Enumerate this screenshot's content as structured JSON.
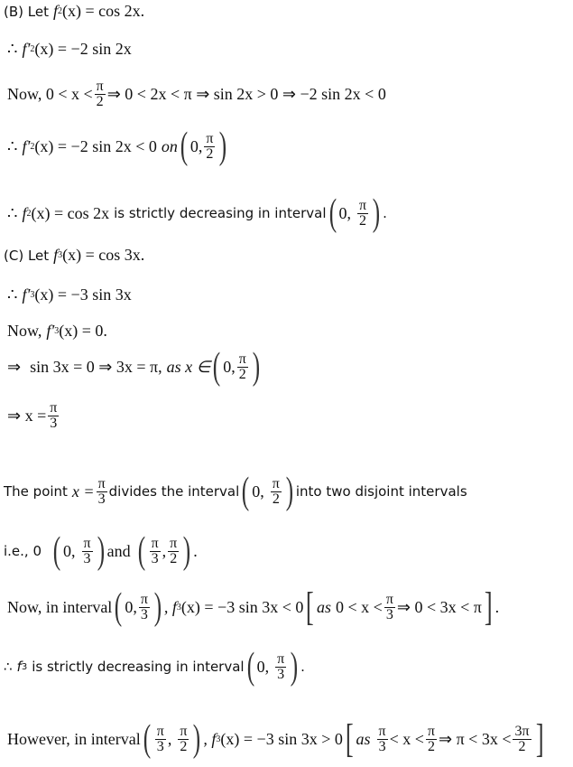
{
  "partB": {
    "heading": "(B) Let",
    "def": {
      "f": "f",
      "sub": "2",
      "rest": "(x) = cos 2x."
    },
    "deriv": {
      "therefore": "∴",
      "f": "f′",
      "sub": "2",
      "rest": "(x) = −2 sin 2x"
    },
    "now": {
      "prefix": "Now, 0 < x <",
      "num": "π",
      "den": "2",
      "suffix": "⇒ 0 < 2x < π ⇒ sin 2x > 0 ⇒ −2 sin 2x < 0"
    },
    "neg": {
      "therefore": "∴",
      "f": "f′",
      "sub": "2",
      "rest": "(x) = −2 sin 2x < 0",
      "on": "on",
      "lo": "0,",
      "num": "π",
      "den": "2"
    },
    "conclusion": {
      "therefore": "∴",
      "f": "f",
      "sub": "2",
      "math": "(x) = cos 2x",
      "text": "is strictly decreasing in interval",
      "lo": "0,",
      "num": "π",
      "den": "2",
      "end": "."
    }
  },
  "partC": {
    "heading": "(C) Let",
    "def": {
      "f": "f",
      "sub": "3",
      "rest": "(x) = cos 3x."
    },
    "deriv": {
      "therefore": "∴",
      "f": "f′",
      "sub": "3",
      "rest": "(x) = −3 sin 3x"
    },
    "zero": {
      "prefix": "Now,",
      "f": "f′",
      "sub": "3",
      "rest": "(x) = 0."
    },
    "solve": {
      "arrow": "⇒",
      "text": "sin 3x = 0 ⇒ 3x = π,",
      "as": "as x ∈",
      "lo": "0,",
      "num": "π",
      "den": "2"
    },
    "root": {
      "prefix": "⇒ x =",
      "num": "π",
      "den": "3"
    },
    "divides": {
      "pre": "The point",
      "xeq": "x =",
      "num": "π",
      "den": "3",
      "mid": "divides the interval",
      "lo": "0,",
      "num2": "π",
      "den2": "2",
      "post": "into two disjoint intervals"
    },
    "ie": {
      "pre": "i.e., 0",
      "lo": "0,",
      "num": "π",
      "den": "3",
      "and": "and",
      "num2": "π",
      "den2": "3",
      "num3": "π",
      "den3": "2",
      "end": "."
    },
    "first": {
      "pre": "Now, in interval",
      "lo": "0,",
      "num": "π",
      "den": "3",
      "f": ", f",
      "sub": "3",
      "rest": "(x) = −3 sin 3x < 0",
      "as": "as",
      "cond": "0 < x <",
      "cnum": "π",
      "cden": "3",
      "cond2": "⇒ 0 < 3x < π",
      "end": "."
    },
    "dec": {
      "therefore": "∴",
      "f": "f",
      "sub": "3",
      "text": "is strictly decreasing in interval",
      "lo": "0,",
      "num": "π",
      "den": "3",
      "end": "."
    },
    "second": {
      "pre": "However, in interval",
      "num": "π",
      "den": "3",
      "num2": "π",
      "den2": "2",
      "f": ", f",
      "sub": "3",
      "rest": "(x) = −3 sin 3x > 0",
      "as": "as",
      "cnum": "π",
      "cden": "3",
      "c1": "< x <",
      "cnum2": "π",
      "cden2": "2",
      "c2": "⇒ π < 3x <",
      "cnum3": "3π",
      "cden3": "2"
    }
  }
}
